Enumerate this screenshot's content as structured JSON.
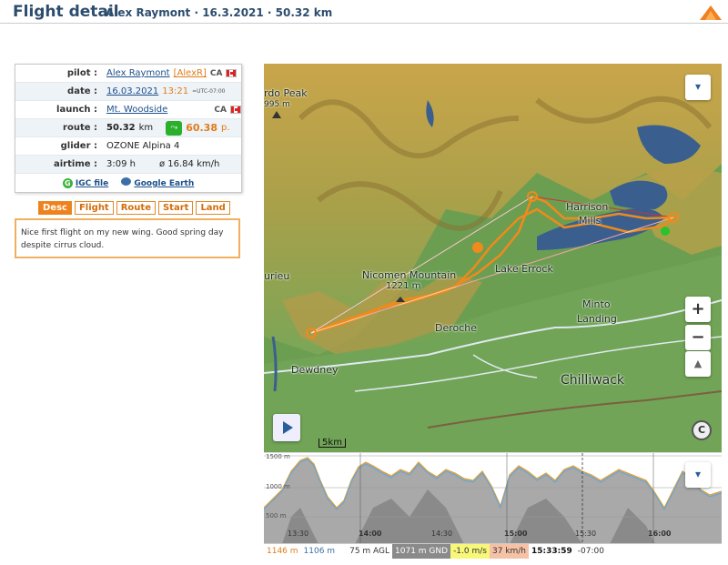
{
  "header": {
    "title": "Flight detail",
    "subtitle": "Alex Raymont · 16.3.2021 · 50.32 km"
  },
  "info": {
    "pilot_label": "pilot :",
    "pilot_name": "Alex Raymont",
    "pilot_nick": "[AlexR]",
    "pilot_country": "CA",
    "date_label": "date :",
    "date_value": "16.03.2021",
    "time_value": "13:21",
    "tz_value": "=UTC-07:00",
    "launch_label": "launch :",
    "launch_value": "Mt. Woodside",
    "launch_country": "CA",
    "route_label": "route :",
    "route_km": "50.32",
    "route_unit": "km",
    "route_points": "60.38",
    "route_points_unit": "p.",
    "glider_label": "glider :",
    "glider_value": "OZONE Alpina 4",
    "airtime_label": "airtime :",
    "airtime_value": "3:09 h",
    "avg_speed": "ø 16.84 km/h",
    "igc_label": "IGC file",
    "ge_label": "Google Earth"
  },
  "tabs": [
    {
      "label": "Desc",
      "active": true
    },
    {
      "label": "Flight",
      "active": false
    },
    {
      "label": "Route",
      "active": false
    },
    {
      "label": "Start",
      "active": false
    },
    {
      "label": "Land",
      "active": false
    }
  ],
  "description": "Nice first flight on my new wing. Good spring day despite cirrus cloud.",
  "map": {
    "labels": {
      "peak": "rdo Peak",
      "peak_alt": "995 m",
      "harrison": "Harrison",
      "harrison2": "Mills",
      "nicomen": "Nicomen Mountain",
      "nicomen_alt": "1221 m",
      "lake_errock": "Lake Errock",
      "minto": "Minto",
      "landing": "Landing",
      "deroche": "Deroche",
      "dewdney": "Dewdney",
      "chilliwack": "Chilliwack",
      "rieu": "urieu"
    },
    "scale_label": "5km",
    "zoom_in": "+",
    "zoom_out": "−",
    "compass": "▲",
    "copyright": "C",
    "layers_icon": "▾"
  },
  "profile": {
    "alt_labels": [
      "1500 m",
      "1000 m",
      "500 m"
    ],
    "time_labels": [
      "13:30",
      "14:00",
      "14:30",
      "15:00",
      "15:30",
      "16:00"
    ]
  },
  "status": {
    "alt_gps": "1146 m",
    "alt_baro": "1106 m",
    "agl": "75 m AGL",
    "gnd": "1071 m GND",
    "vario": "-1.0 m/s",
    "speed": "37 km/h",
    "time": "15:33:59",
    "tz": "-07:00"
  }
}
